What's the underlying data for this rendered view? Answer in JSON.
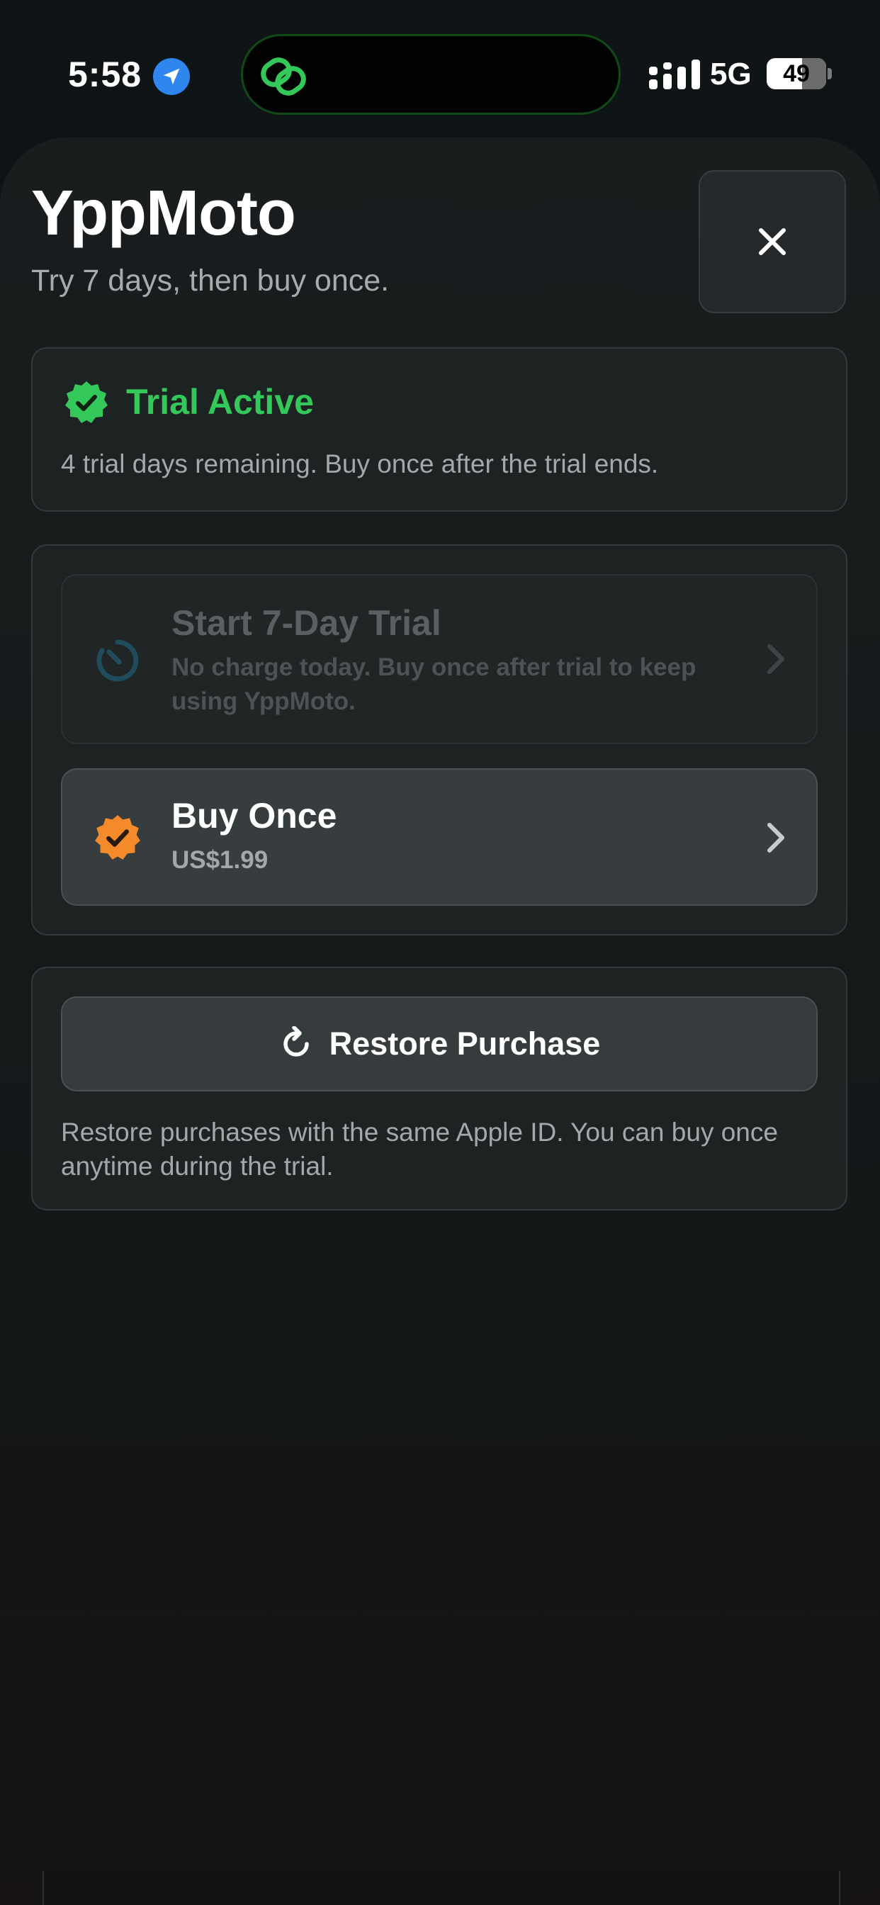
{
  "status_bar": {
    "time": "5:58",
    "network": "5G",
    "battery_level": "49",
    "location_icon": "location-arrow-icon",
    "activity_icon": "link-icon",
    "accent_color": "#2f86ef",
    "island_accent": "#34c759"
  },
  "header": {
    "title": "YppMoto",
    "subtitle": "Try 7 days, then buy once.",
    "close_icon": "close-icon"
  },
  "trial_status": {
    "title": "Trial Active",
    "description": "4 trial days remaining. Buy once after the trial ends.",
    "icon": "verified-badge-icon",
    "color": "#34c759"
  },
  "options": [
    {
      "title": "Start 7-Day Trial",
      "subtitle": "No charge today. Buy once after trial to keep using YppMoto.",
      "icon": "timer-icon",
      "disabled": true
    },
    {
      "title": "Buy Once",
      "subtitle": "US$1.99",
      "icon": "verified-badge-icon",
      "color": "#f58a2b",
      "disabled": false
    }
  ],
  "restore": {
    "button_label": "Restore Purchase",
    "icon": "refresh-icon",
    "note": "Restore purchases with the same Apple ID. You can buy once anytime during the trial."
  }
}
